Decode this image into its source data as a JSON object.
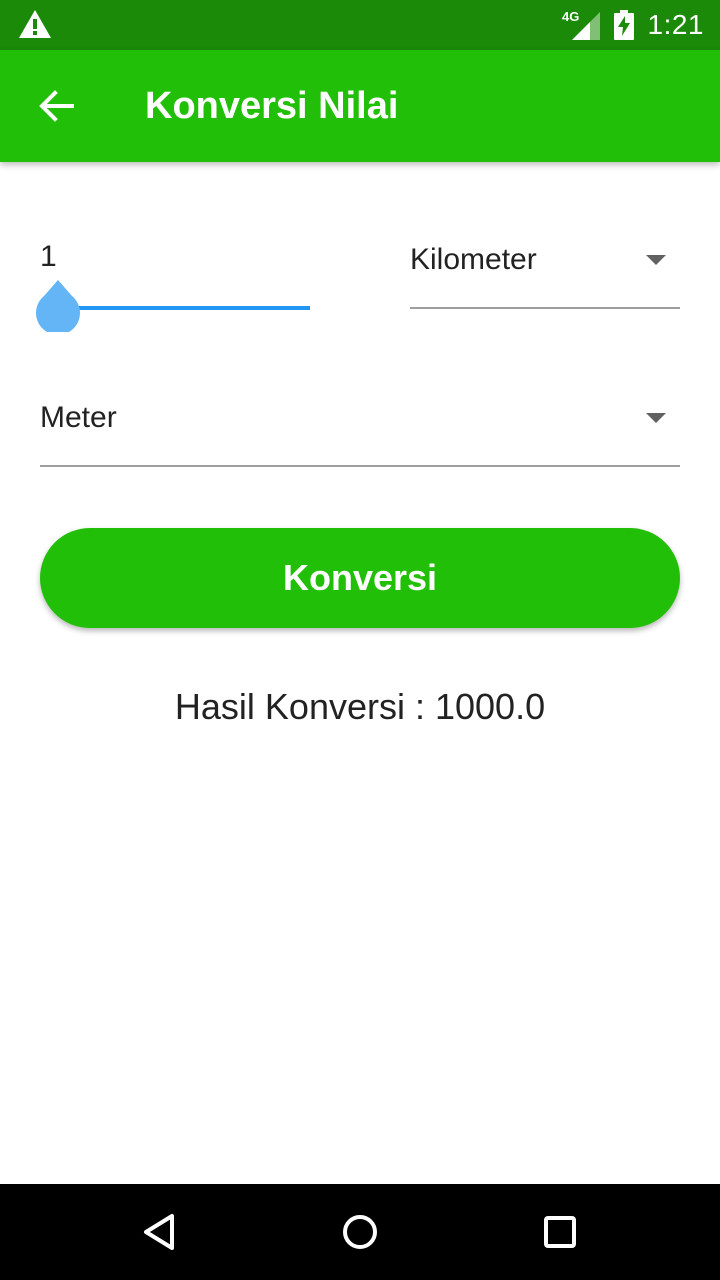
{
  "status_bar": {
    "time": "1:21",
    "network": "4G",
    "icons": [
      "warning-icon",
      "4g-signal-icon",
      "battery-charging-icon"
    ]
  },
  "app_bar": {
    "title": "Konversi Nilai",
    "back_icon": "arrow-back-icon"
  },
  "converter": {
    "input_value": "1",
    "slider_level": 0.0,
    "from_unit": "Kilometer",
    "to_unit": "Meter",
    "convert_label": "Konversi",
    "result_text": "Hasil Konversi : 1000.0"
  },
  "nav_bar": {
    "icons": [
      "nav-back-icon",
      "nav-home-icon",
      "nav-recents-icon"
    ]
  },
  "colors": {
    "status_bar": "#1a8a08",
    "primary": "#22bf08",
    "slider_accent": "#2196f3",
    "slider_thumb": "#64b5f6",
    "nav_bar": "#000000"
  }
}
